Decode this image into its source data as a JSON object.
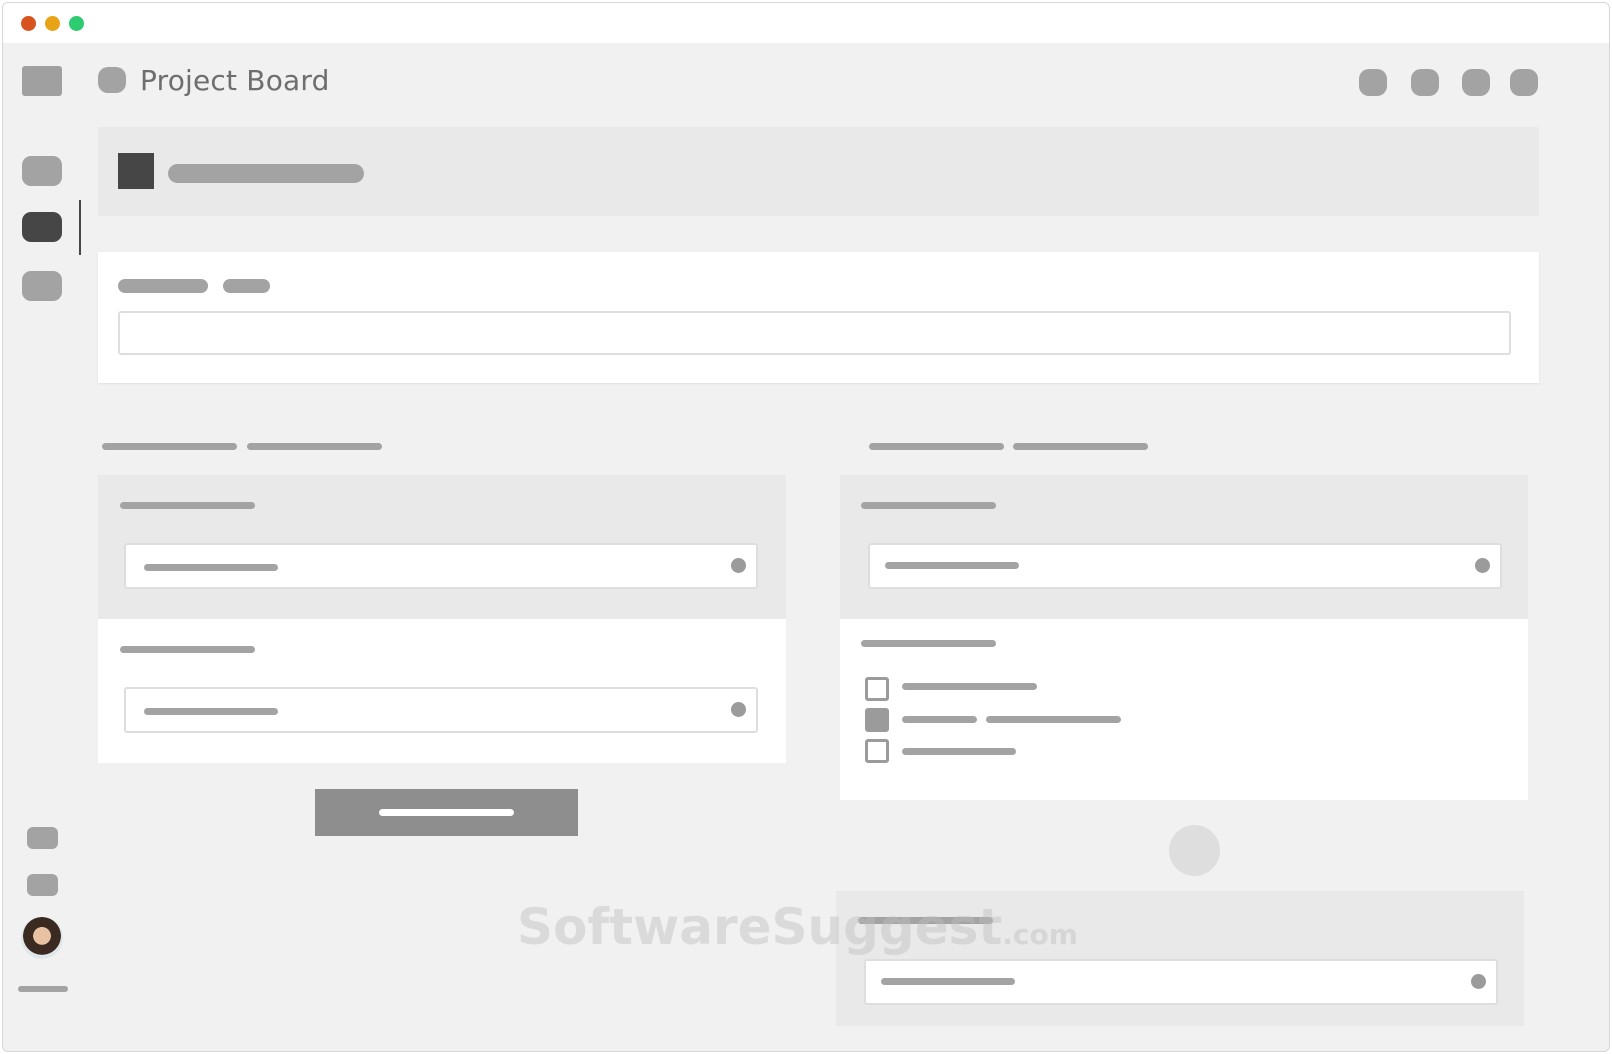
{
  "window": {
    "controls": [
      "close",
      "minimize",
      "maximize"
    ],
    "colors": {
      "close": "#d9531e",
      "minimize": "#e8a317",
      "maximize": "#2ecc71"
    }
  },
  "header": {
    "title": "Project Board",
    "actions": [
      "action-1-icon",
      "action-2-icon",
      "action-3-icon",
      "action-4-icon"
    ]
  },
  "sidebar": {
    "items": [
      "nav-item-1",
      "nav-item-2",
      "nav-item-3"
    ],
    "active_item": "nav-item-2",
    "bottom_items": [
      "bottom-item-1",
      "bottom-item-2"
    ],
    "avatar": "user-avatar"
  },
  "form": {
    "search_value": "",
    "checkboxes": [
      {
        "checked": false
      },
      {
        "checked": true
      },
      {
        "checked": false
      }
    ]
  },
  "watermark": {
    "name": "SoftwareSuggest",
    "tld": ".com"
  },
  "theme": {
    "dark": "#464646",
    "placeholder": "#a3a3a3",
    "button": "#8e8e8e",
    "panel": "#e9e9e9"
  }
}
